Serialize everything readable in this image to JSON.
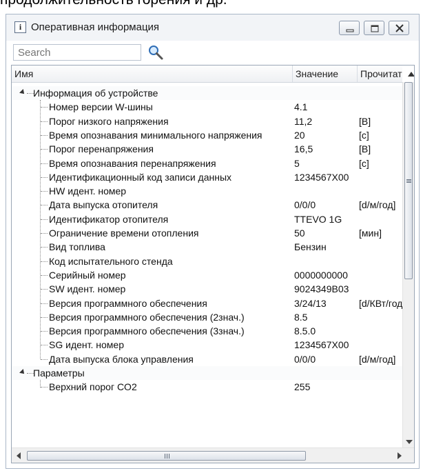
{
  "top_caption": "продолжительность горения и др.",
  "window": {
    "title": "Оперативная информация",
    "title_icon": "info-icon",
    "controls": [
      "minimize-icon",
      "maximize-icon",
      "close-icon"
    ]
  },
  "search": {
    "placeholder": "Search",
    "value": "Search",
    "icon": "magnifier-icon"
  },
  "columns": [
    "Имя",
    "Значение",
    "Прочитать"
  ],
  "groups": [
    {
      "label": "Информация об устройстве",
      "rows": [
        {
          "name": "Номер версии W-шины",
          "value": "4.1",
          "unit": ""
        },
        {
          "name": "Порог низкого напряжения",
          "value": "11,2",
          "unit": "[В]"
        },
        {
          "name": "Время опознавания минимального напряжения",
          "value": "20",
          "unit": "[с]"
        },
        {
          "name": "Порог перенапряжения",
          "value": "16,5",
          "unit": "[В]"
        },
        {
          "name": "Время опознавания перенапряжения",
          "value": "5",
          "unit": "[с]"
        },
        {
          "name": "Идентификационный код записи данных",
          "value": "1234567X00",
          "unit": ""
        },
        {
          "name": "HW идент. номер",
          "value": "",
          "unit": ""
        },
        {
          "name": "Дата выпуска отопителя",
          "value": "0/0/0",
          "unit": "[d/м/год]"
        },
        {
          "name": "Идентификатор отопителя",
          "value": "TTEVO 1G",
          "unit": ""
        },
        {
          "name": "Ограничение времени отопления",
          "value": "50",
          "unit": "[мин]"
        },
        {
          "name": "Вид топлива",
          "value": "Бензин",
          "unit": ""
        },
        {
          "name": "Код испытательного стенда",
          "value": "",
          "unit": ""
        },
        {
          "name": "Серийный номер",
          "value": "0000000000",
          "unit": ""
        },
        {
          "name": "SW идент. номер",
          "value": "9024349B03",
          "unit": ""
        },
        {
          "name": "Версия программного обеспечения",
          "value": "3/24/13",
          "unit": "[d/КВт/год]"
        },
        {
          "name": "Версия программного обеспечения (2знач.)",
          "value": "8.5",
          "unit": ""
        },
        {
          "name": "Версия программного обеспечения (3знач.)",
          "value": "8.5.0",
          "unit": ""
        },
        {
          "name": "SG идент. номер",
          "value": "1234567X00",
          "unit": ""
        },
        {
          "name": "Дата выпуска блока управления",
          "value": "0/0/0",
          "unit": "[d/м/год]"
        }
      ]
    },
    {
      "label": "Параметры",
      "rows": [
        {
          "name": "Верхний порог CO2",
          "value": "255",
          "unit": ""
        }
      ]
    }
  ],
  "colors": {
    "border": "#9aa6b5",
    "titlebar": "#f2f4f7",
    "group_bg": "#fafbfc"
  }
}
